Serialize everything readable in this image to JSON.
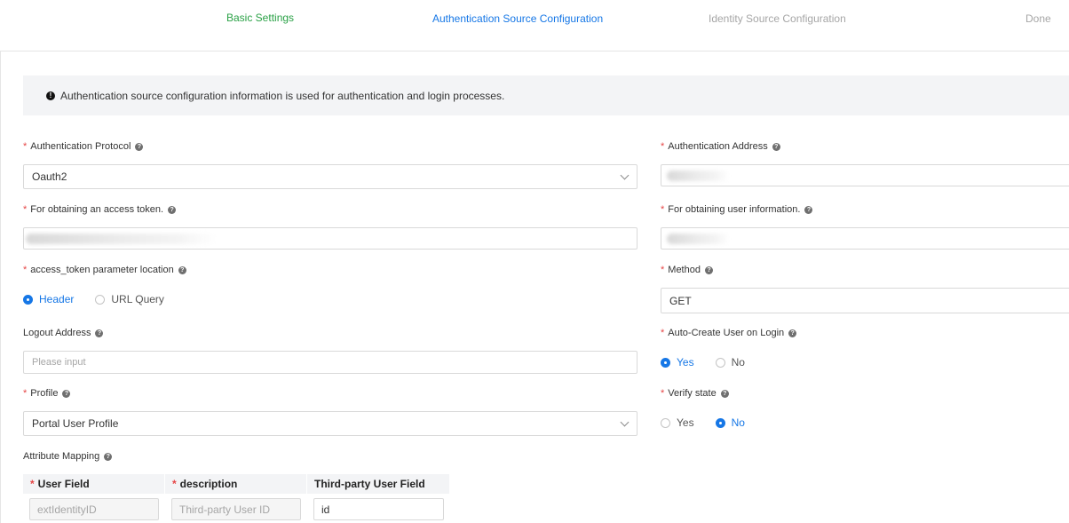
{
  "steps": [
    {
      "label": "Basic Settings",
      "state": "done"
    },
    {
      "label": "Authentication Source Configuration",
      "state": "active"
    },
    {
      "label": "Identity Source Configuration",
      "state": "pending"
    },
    {
      "label": "Done",
      "state": "pending"
    }
  ],
  "info": {
    "icon": "exclamation-icon",
    "text": "Authentication source configuration information is used for authentication and login processes."
  },
  "form": {
    "auth_protocol": {
      "label": "Authentication Protocol",
      "value": "Oauth2"
    },
    "auth_address": {
      "label": "Authentication Address"
    },
    "access_token_url": {
      "label": "For obtaining an access token."
    },
    "user_info_url": {
      "label": "For obtaining user information."
    },
    "token_location": {
      "label": "access_token parameter location",
      "options": [
        "Header",
        "URL Query"
      ],
      "selected": "Header"
    },
    "method": {
      "label": "Method",
      "value": "GET"
    },
    "logout_address": {
      "label": "Logout Address",
      "placeholder": "Please input"
    },
    "auto_create_user": {
      "label": "Auto-Create User on Login",
      "options": [
        "Yes",
        "No"
      ],
      "selected": "Yes"
    },
    "profile": {
      "label": "Profile",
      "value": "Portal User Profile"
    },
    "verify_state": {
      "label": "Verify state",
      "options": [
        "Yes",
        "No"
      ],
      "selected": "No"
    },
    "attribute_mapping": {
      "label": "Attribute Mapping",
      "headers": [
        "User Field",
        "description",
        "Third-party User Field"
      ],
      "row": [
        "extIdentityID",
        "Third-party User ID",
        "id"
      ]
    }
  },
  "colors": {
    "accent": "#1677e6",
    "success": "#2aa146",
    "required": "#e64545"
  }
}
